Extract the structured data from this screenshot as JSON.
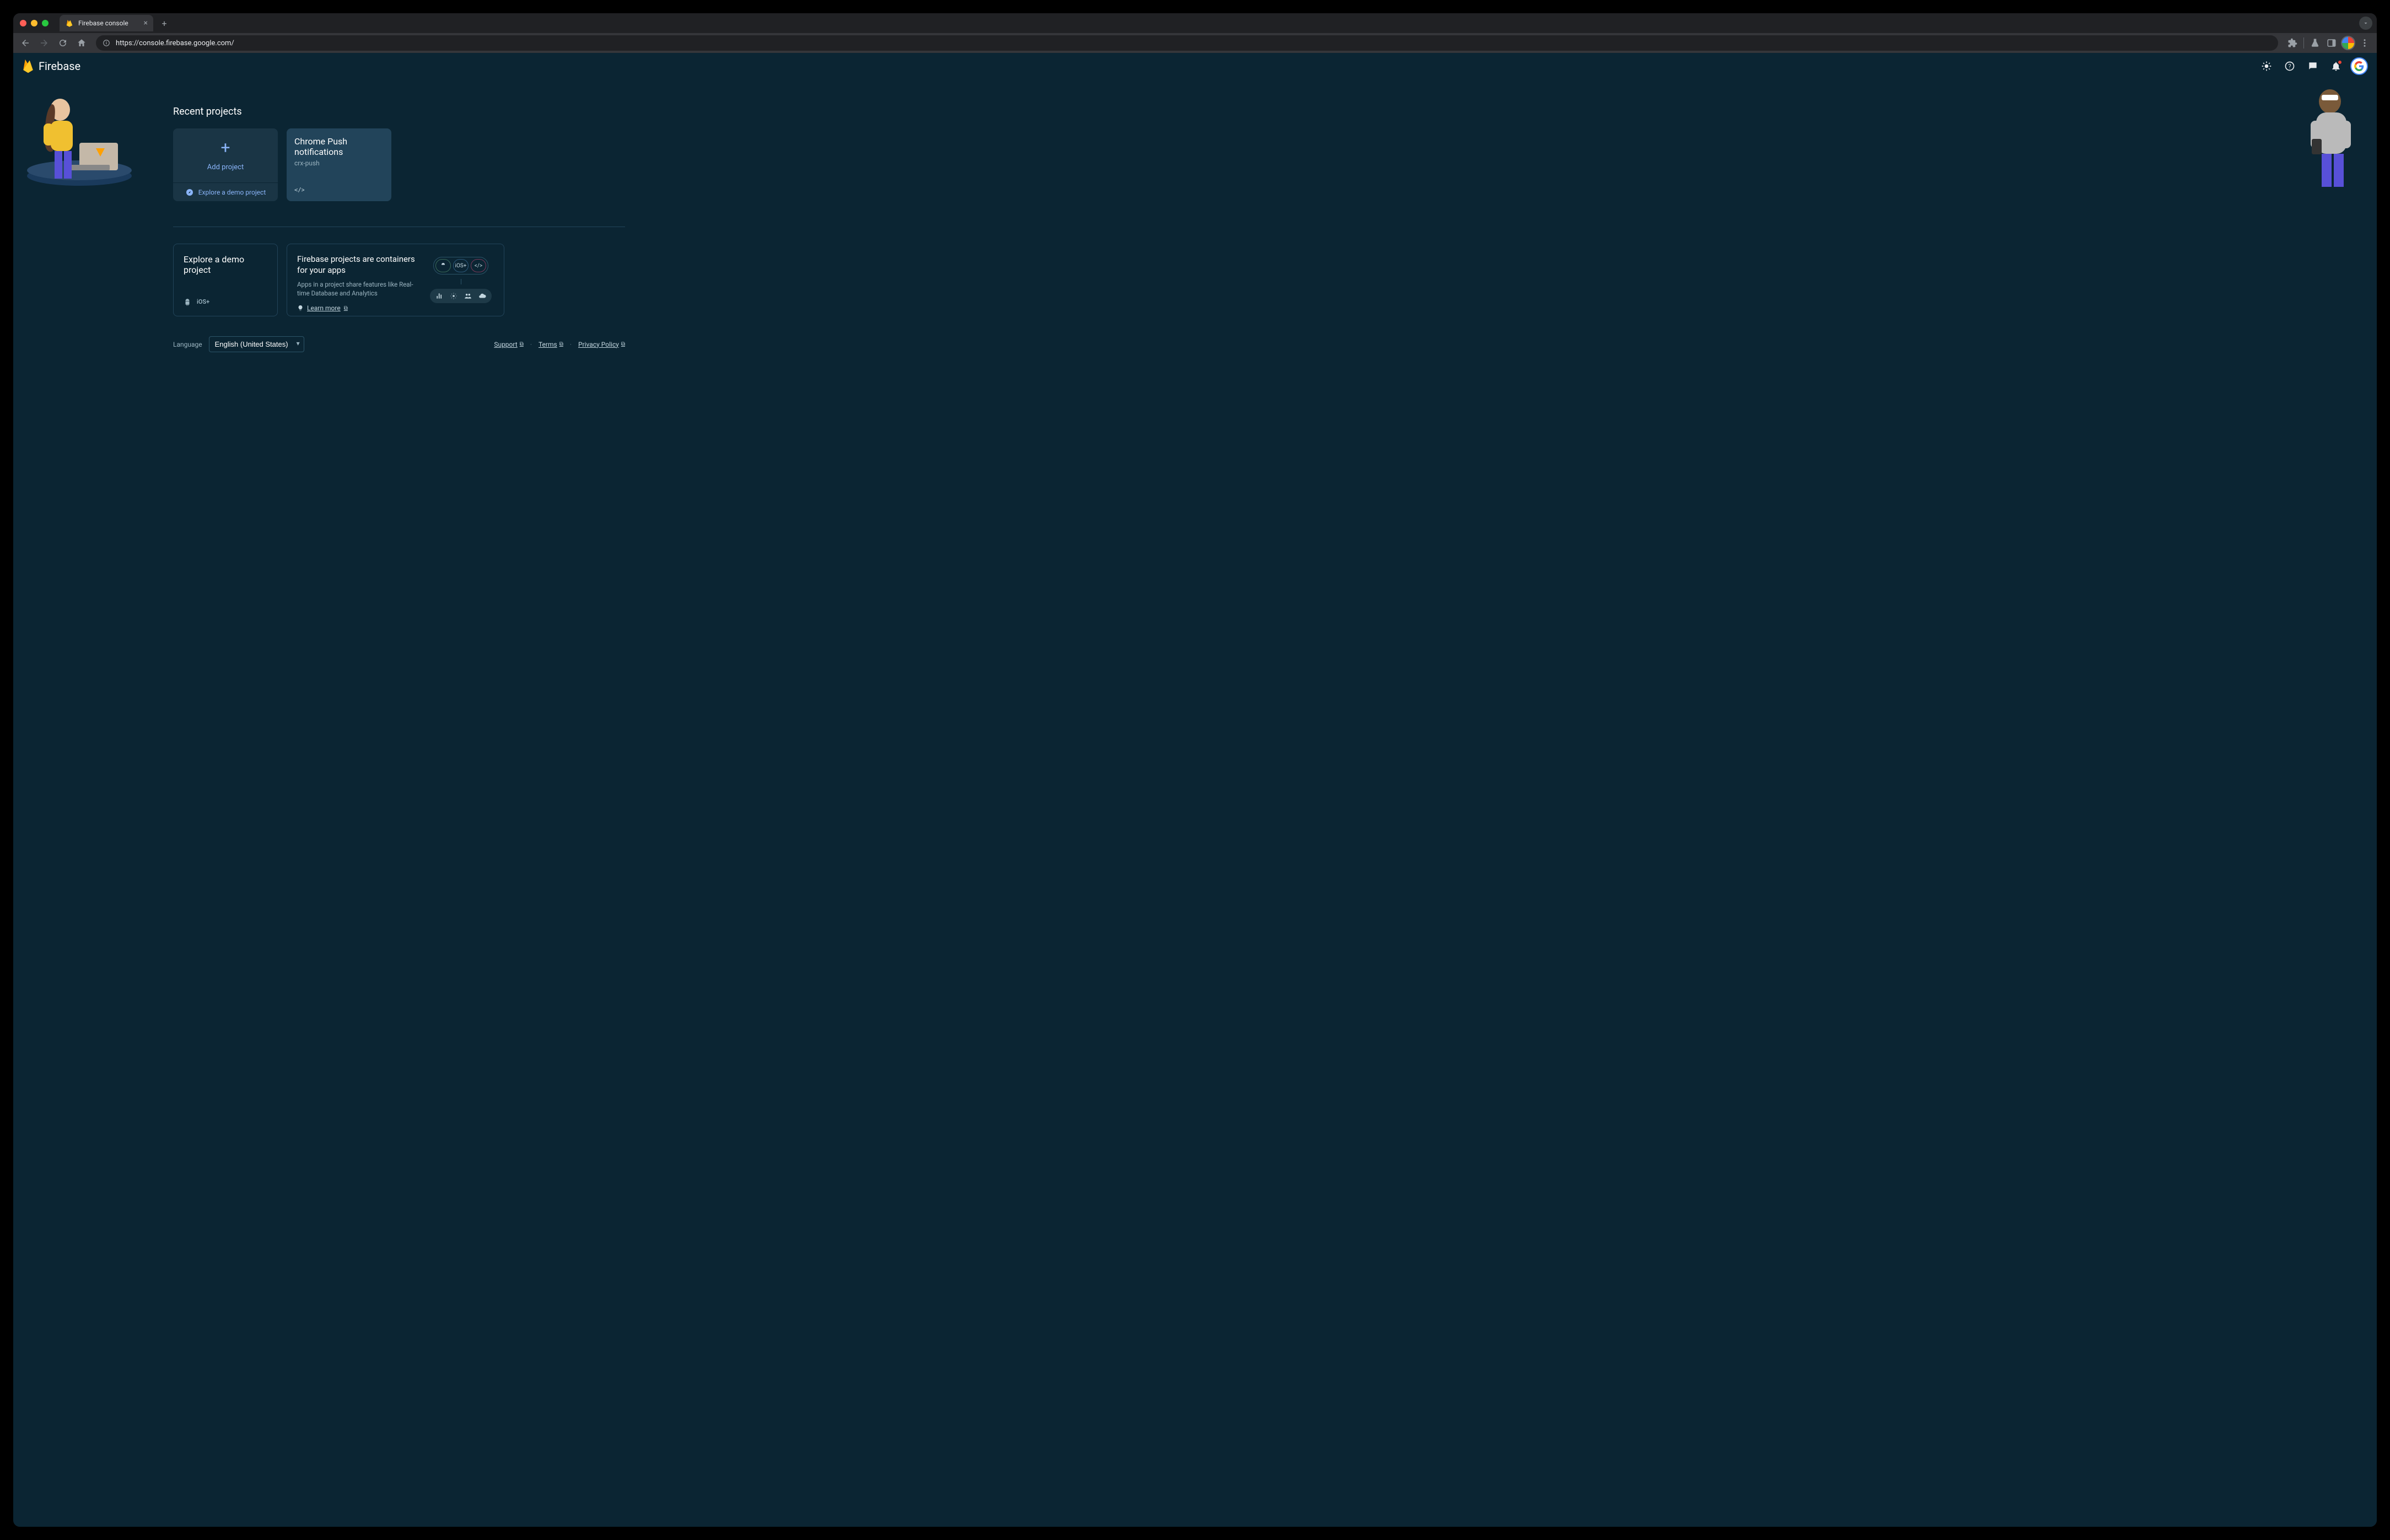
{
  "browser": {
    "tab_title": "Firebase console",
    "url": "https://console.firebase.google.com/"
  },
  "appbar": {
    "brand": "Firebase"
  },
  "recent": {
    "heading": "Recent projects",
    "add_label": "Add project",
    "demo_link": "Explore a demo project",
    "projects": [
      {
        "name": "Chrome Push notifications",
        "id": "crx-push"
      }
    ]
  },
  "explore_card": {
    "title": "Explore a demo project"
  },
  "container_card": {
    "title": "Firebase projects are containers for your apps",
    "desc": "Apps in a project share features like Real-time Database and Analytics",
    "learn_more": "Learn more"
  },
  "footer": {
    "language_label": "Language",
    "language_value": "English (United States)",
    "support": "Support",
    "terms": "Terms",
    "privacy": "Privacy Policy"
  }
}
